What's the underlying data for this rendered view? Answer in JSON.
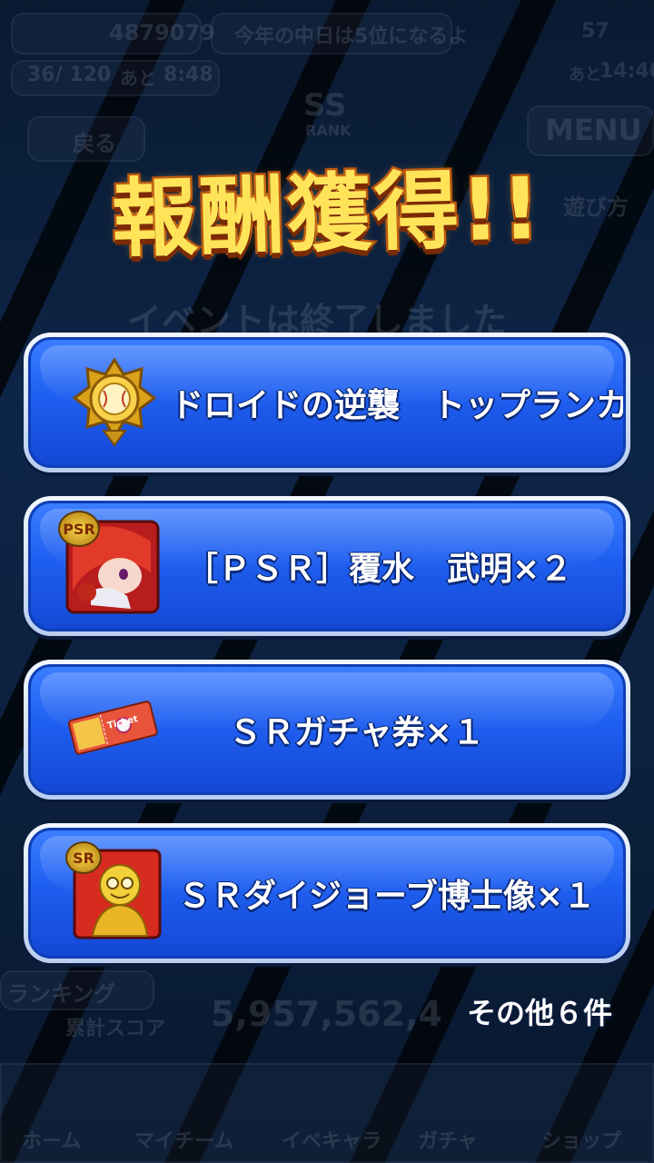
{
  "background": {
    "score_top": "4879079",
    "news_banner": "今年の中日は5位になるよ",
    "stamina": "36/ 120",
    "stamina_timer_label": "あと",
    "stamina_timer": "8:48",
    "right_count": "57",
    "right_timer_label": "あと",
    "right_timer": "14:40",
    "back_button": "戻る",
    "menu_button": "MENU",
    "howto_button": "遊び方",
    "rank_badge": "SS",
    "rank_label": "RANK",
    "event_ended": "イベントは終了しました",
    "ranking_tab": "ランキング",
    "total_score_label": "累計スコア",
    "total_score": "5,957,562,4",
    "nav_home": "ホーム",
    "nav_myteam": "マイチーム",
    "nav_ikechara": "イベキャラ",
    "nav_gacha": "ガチャ",
    "nav_shop": "ショップ"
  },
  "popup": {
    "title": "報酬獲得!!",
    "rewards": [
      {
        "label": "ドロイドの逆襲　トップランカー",
        "icon": "gold-medal-icon"
      },
      {
        "label": "［ＰＳＲ］覆水　武明×２",
        "icon": "psr-character-card-icon",
        "badge": "PSR"
      },
      {
        "label": "ＳＲガチャ券×１",
        "icon": "gacha-ticket-icon",
        "ticket_text": "Ticket"
      },
      {
        "label": "ＳＲダイジョーブ博士像×１",
        "icon": "golden-statue-icon",
        "badge": "SR"
      }
    ],
    "more_label": "その他６件"
  },
  "colors": {
    "card_blue": "#1f5ff0",
    "title_yellow": "#ffe45a",
    "title_outline": "#b34a0c",
    "gold": "#e8b525"
  }
}
